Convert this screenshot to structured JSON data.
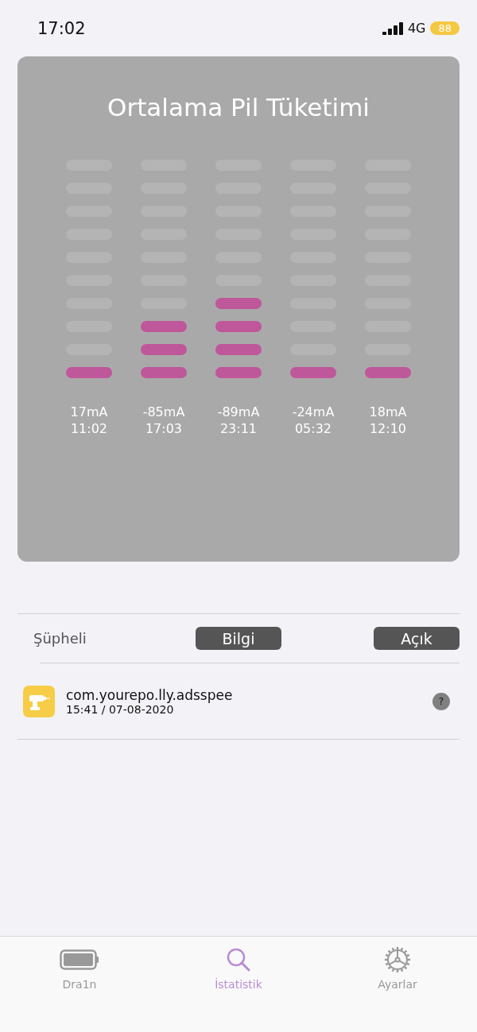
{
  "status_bar": {
    "time": "17:02",
    "network": "4G",
    "battery": "88"
  },
  "card": {
    "title": "Ortalama Pil Tüketimi",
    "columns": [
      {
        "level": 0.1,
        "current": "17mA",
        "time": "11:02"
      },
      {
        "level": 0.3,
        "current": "-85mA",
        "time": "17:03"
      },
      {
        "level": 0.4,
        "current": "-89mA",
        "time": "23:11"
      },
      {
        "level": 0.1,
        "current": "-24mA",
        "time": "05:32"
      },
      {
        "level": 0.1,
        "current": "18mA",
        "time": "12:10"
      }
    ]
  },
  "header": {
    "label": "Şüpheli",
    "buttons": [
      "Bilgi",
      "Açık"
    ]
  },
  "apps": [
    {
      "name": "com.yourepo.lly.adsspee",
      "time": "15:41 / 07-08-2020",
      "help": "?"
    }
  ],
  "tab_bar": [
    {
      "label": "Dra1n",
      "kind": "battery",
      "selected": false
    },
    {
      "label": "İstatistik",
      "kind": "search",
      "selected": true
    },
    {
      "label": "Ayarlar",
      "kind": "gear",
      "selected": false
    }
  ]
}
